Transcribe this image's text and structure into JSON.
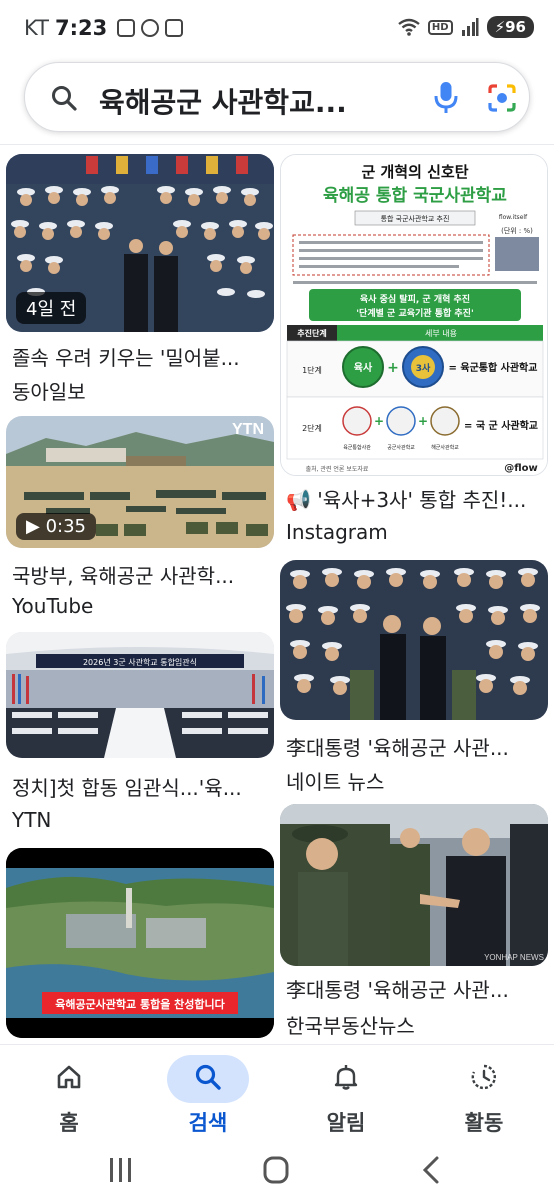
{
  "status_bar": {
    "carrier": "KT",
    "time": "7:23",
    "hd": "HD",
    "battery": "96"
  },
  "search": {
    "query": "육해공군 사관학교...",
    "icons": [
      "search-icon",
      "mic-icon",
      "lens-icon"
    ]
  },
  "results": [
    {
      "id": "r1",
      "caption": "졸속 우려 키우는 '밀어붙...",
      "source": "동아일보",
      "badge": "4일 전"
    },
    {
      "id": "r2",
      "caption": "'육사+3사' 통합 추진!...",
      "source": "Instagram",
      "headline1": "군 개혁의 신호탄",
      "headline2": "육해공 통합 국군사관학교",
      "subhead": "통합 국군사관학교 추진",
      "unit": "(단위 : %)",
      "flow_tag": "flow.itself",
      "flow_logo": "@flow",
      "green_banner1": "육사 중심 탈피, 군 개혁 추진",
      "green_banner2": "'단계별 군 교육기관 통합 추진'",
      "table_header1": "추진단계",
      "table_header2": "세부 내용",
      "stage1": "1단계",
      "stage2": "2단계",
      "stage1_result": "= 육군통합 사관학교",
      "stage2_result": "= 국 군 사관학교",
      "emblem1": "육사",
      "emblem2": "3사",
      "label_a": "육군통합사관",
      "label_b": "공군사관학교",
      "label_c": "해군사관학교",
      "footer": "출처, 관련 언론 보도자료"
    },
    {
      "id": "r3",
      "caption": "국방부, 육해공군 사관학...",
      "source": "YouTube",
      "badge": "0:35",
      "watermark": "YTN"
    },
    {
      "id": "r4",
      "caption": "李대통령 '육해공군 사관...",
      "source": "네이트 뉴스"
    },
    {
      "id": "r5",
      "caption": "정치]첫 합동 임관식...'육...",
      "source": "YTN",
      "stage_banner": "2026년 3군 사관학교 통합임관식"
    },
    {
      "id": "r6",
      "caption": "李대통령 '육해공군 사관...",
      "source": "한국부동산뉴스",
      "watermark": "YONHAP NEWS"
    },
    {
      "id": "r7",
      "red_banner": "육해공군사관학교 통합을 찬성합니다"
    }
  ],
  "bottom_nav": {
    "items": [
      {
        "label": "홈",
        "icon": "home-icon",
        "active": false
      },
      {
        "label": "검색",
        "icon": "search-icon",
        "active": true
      },
      {
        "label": "알림",
        "icon": "bell-icon",
        "active": false
      },
      {
        "label": "활동",
        "icon": "activity-icon",
        "active": false
      }
    ]
  },
  "system_nav": {
    "icons": [
      "recents-icon",
      "home-circle-icon",
      "back-icon"
    ]
  },
  "colors": {
    "accent_blue": "#0b57d0",
    "active_pill": "#d3e3fd",
    "red_banner": "#e8262b",
    "green_banner": "#2e9e45"
  }
}
